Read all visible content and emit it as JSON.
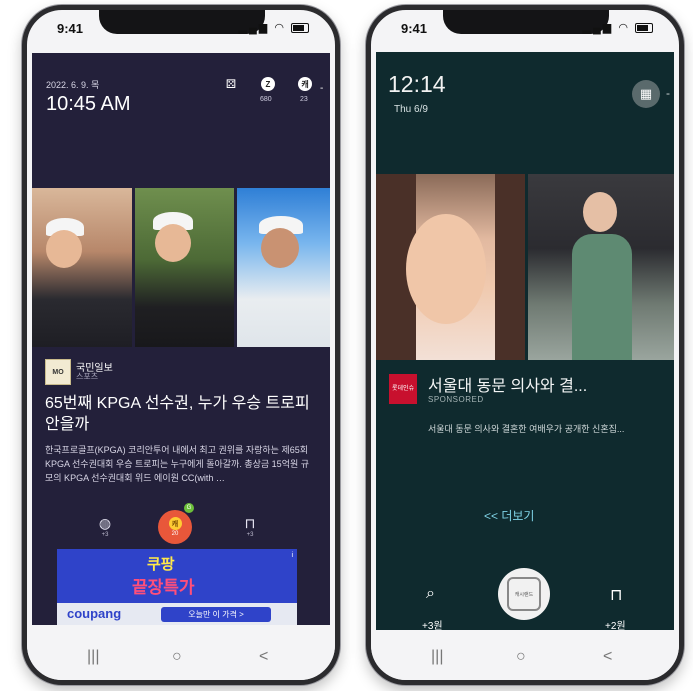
{
  "left_phone": {
    "status_time": "9:41",
    "date": "2022. 6. 9. 목",
    "clock": "10:45 AM",
    "top_icons": [
      {
        "icon": "gamepad-icon",
        "label": ""
      },
      {
        "icon": "z-coin-icon",
        "glyph": "Z",
        "label": "680"
      },
      {
        "icon": "cash-coin-icon",
        "glyph": "캐",
        "label": "23"
      }
    ],
    "more_dash": "-",
    "publisher": {
      "logo_text": "MO",
      "name": "국민일보",
      "section": "스포츠"
    },
    "headline": "65번째 KPGA 선수권, 누가 우승 트로피 안을까",
    "summary": "한국프로골프(KPGA) 코리안투어 내에서 최고 권위를 자랑하는 제65회 KPGA 선수권대회 우승 트로피는 누구에게 돌아갈까. 총상금 15억원 규모의 KPGA 선수권대회 위드 에이원 CC(with …",
    "actions": {
      "left_label": "+3",
      "center_coin": "캐",
      "center_count": "20",
      "badge": "G",
      "right_label": "+3"
    },
    "ad": {
      "line1": "쿠팡",
      "line2": "끝장특가",
      "brand": "coupang",
      "cta": "오늘만 이 가격 >",
      "info": "i"
    },
    "nav": [
      "|||",
      "○",
      "<"
    ]
  },
  "right_phone": {
    "status_time": "9:41",
    "clock": "12:14",
    "date": "Thu 6/9",
    "dash": "-",
    "sponsor_logo": "롯데인슈",
    "title": "서울대 동문 의사와 결...",
    "label": "SPONSORED",
    "description": "서울대 동문 의사와 결혼한 여배우가 공개한 신혼집...",
    "more": "<< 더보기",
    "left_amount": "+3원",
    "right_amount": "+2원",
    "center_label": "캐시랜드",
    "nav": [
      "|||",
      "○",
      "<"
    ]
  }
}
